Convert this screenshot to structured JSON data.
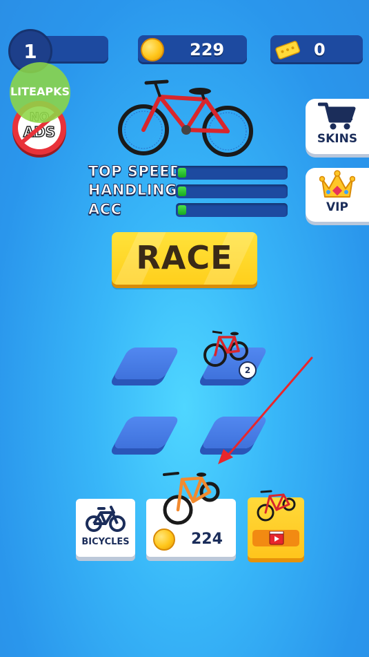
{
  "hud": {
    "level": "1",
    "coins": "229",
    "tickets": "0"
  },
  "watermark": {
    "text": "LITEAPKS"
  },
  "no_ads": {
    "text_top": "NO",
    "text_bottom": "ADS"
  },
  "side_buttons": {
    "skins_label": "SKINS",
    "vip_label": "VIP"
  },
  "stats": [
    {
      "label": "TOP SPEED",
      "fill": 0.08
    },
    {
      "label": "HANDLING",
      "fill": 0.08
    },
    {
      "label": "ACC",
      "fill": 0.08
    }
  ],
  "race_button": {
    "label": "RACE"
  },
  "merge_grid": {
    "slot_badge": "2"
  },
  "bottom_bar": {
    "bicycles_label": "BICYCLES",
    "buy_price": "224"
  },
  "colors": {
    "background": "#38b6f8",
    "hud_pill": "#1d4aa0",
    "race_button": "#ffd72a",
    "bike_frame_red": "#d8262c",
    "bike_frame_orange": "#f28a2e",
    "arrow": "#e8262c"
  }
}
